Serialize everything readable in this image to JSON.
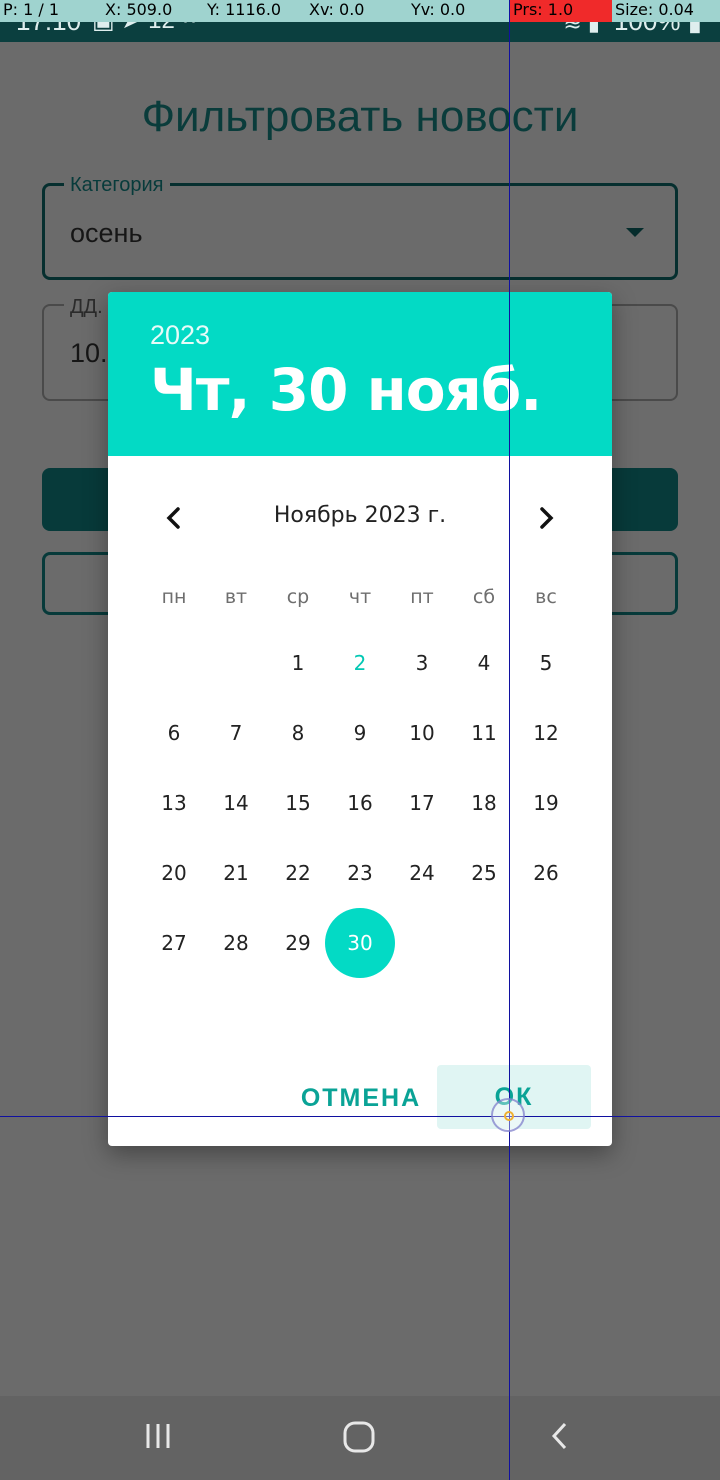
{
  "status_bar": {
    "time": "17:10",
    "battery": "100%",
    "left_icons": [
      "image-icon",
      "telegram-icon",
      "notification-count-icon",
      "more-icon"
    ],
    "notification_count": "12",
    "right_icons": [
      "wifi-icon",
      "signal-icon",
      "battery-icon"
    ]
  },
  "debug_overlay": {
    "pointer": "P: 1 / 1",
    "x": "X: 509.0",
    "y": "Y: 1116.0",
    "xv": "Xv: 0.0",
    "yv": "Yv: 0.0",
    "prs": "Prs: 1.0",
    "size": "Size: 0.04"
  },
  "background_screen": {
    "title": "Фильтровать новости",
    "category_label": "Категория",
    "category_value": "осень",
    "date_label": "ДД.",
    "date_value": "10."
  },
  "date_picker": {
    "year": "2023",
    "selected_date": "Чт, 30 нояб.",
    "month_label": "Ноябрь 2023 г.",
    "weekdays": [
      "пн",
      "вт",
      "ср",
      "чт",
      "пт",
      "сб",
      "вс"
    ],
    "weeks": [
      [
        "",
        "",
        "1",
        "2",
        "3",
        "4",
        "5"
      ],
      [
        "6",
        "7",
        "8",
        "9",
        "10",
        "11",
        "12"
      ],
      [
        "13",
        "14",
        "15",
        "16",
        "17",
        "18",
        "19"
      ],
      [
        "20",
        "21",
        "22",
        "23",
        "24",
        "25",
        "26"
      ],
      [
        "27",
        "28",
        "29",
        "30",
        "",
        "",
        ""
      ]
    ],
    "today_day": "2",
    "selected_day": "30",
    "cancel_label": "ОТМЕНА",
    "ok_label": "ОК",
    "accent_color": "#03dac5"
  },
  "nav_bar": {
    "buttons": [
      "recents-icon",
      "home-icon",
      "back-icon"
    ]
  }
}
